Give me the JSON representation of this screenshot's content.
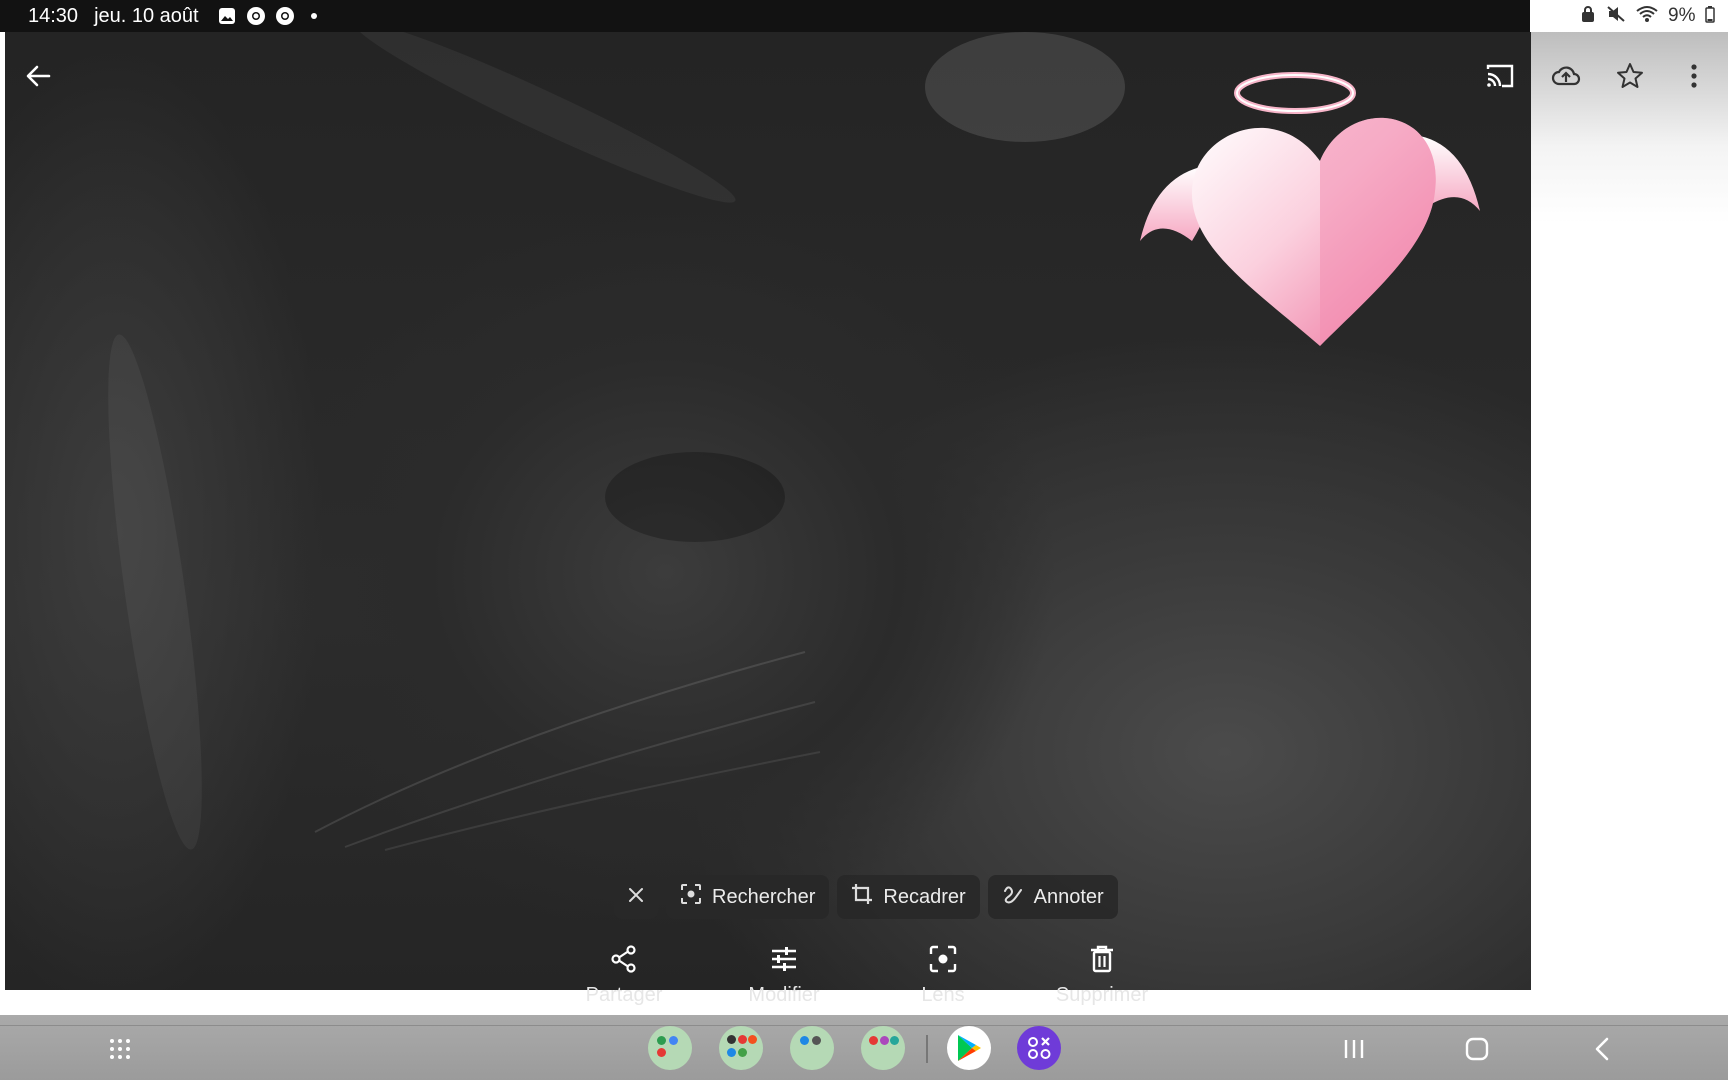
{
  "status_bar": {
    "time": "14:30",
    "date": "jeu. 10 août",
    "notification_icons": [
      "gallery-icon",
      "chrome-icon",
      "chrome-icon",
      "more-notifications-dot-icon"
    ],
    "system_icons": [
      "lock-icon",
      "mute-icon",
      "wifi-icon"
    ],
    "battery": "9%"
  },
  "app_bar": {
    "icons": [
      "back-arrow-icon",
      "cast-icon",
      "cloud-upload-icon",
      "star-icon",
      "more-vert-icon"
    ]
  },
  "photo": {
    "sticker": "angel-heart-icon"
  },
  "chips": {
    "close_icon": "close-icon",
    "search": "Rechercher",
    "crop": "Recadrer",
    "annotate": "Annoter"
  },
  "actions": {
    "share": "Partager",
    "edit": "Modifier",
    "lens": "Lens",
    "delete": "Supprimer"
  },
  "nav_bar": {
    "dock": [
      "folder",
      "folder",
      "folder",
      "folder",
      "play-store-icon",
      "apps-icon"
    ],
    "buttons": [
      "recents-icon",
      "home-icon",
      "back-nav-icon"
    ]
  },
  "colors": {
    "status_bar_bg": "#121212",
    "chip_bg": "#282828",
    "nav_bar_bg": "#a3a3a3",
    "heart_pink": "#f07ca5",
    "folder_green": "#b5d9b5",
    "apps_purple": "#7b3fe4"
  }
}
